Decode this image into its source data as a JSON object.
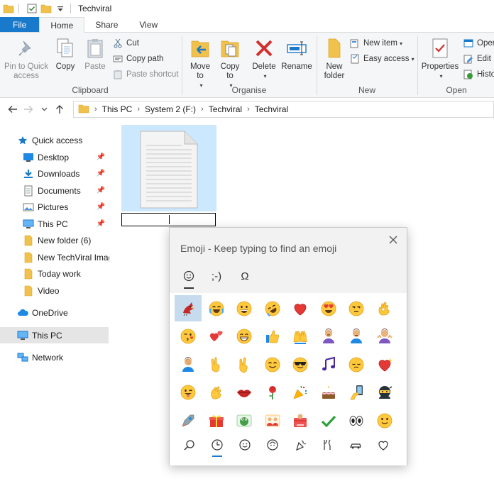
{
  "window": {
    "title": "Techviral"
  },
  "tabs": [
    {
      "label": "File"
    },
    {
      "label": "Home"
    },
    {
      "label": "Share"
    },
    {
      "label": "View"
    }
  ],
  "ribbon": {
    "clipboard": {
      "label": "Clipboard",
      "pin": "Pin to Quick access",
      "copy": "Copy",
      "paste": "Paste",
      "cut": "Cut",
      "copy_path": "Copy path",
      "paste_shortcut": "Paste shortcut"
    },
    "organise": {
      "label": "Organise",
      "move_to": "Move to",
      "copy_to": "Copy to",
      "delete": "Delete",
      "rename": "Rename"
    },
    "new": {
      "label": "New",
      "new_folder": "New folder",
      "new_item": "New item",
      "easy_access": "Easy access"
    },
    "open": {
      "label": "Open",
      "properties": "Properties",
      "open": "Open",
      "edit": "Edit",
      "history": "History"
    }
  },
  "breadcrumb": [
    "This PC",
    "System 2 (F:)",
    "Techviral",
    "Techviral"
  ],
  "nav": {
    "quick_access": "Quick access",
    "items": [
      {
        "label": "Desktop",
        "pinned": true
      },
      {
        "label": "Downloads",
        "pinned": true
      },
      {
        "label": "Documents",
        "pinned": true
      },
      {
        "label": "Pictures",
        "pinned": true
      },
      {
        "label": "This PC",
        "pinned": true
      },
      {
        "label": "New folder (6)",
        "pinned": false
      },
      {
        "label": "New TechViral Images",
        "pinned": false
      },
      {
        "label": "Today work",
        "pinned": false
      },
      {
        "label": "Video",
        "pinned": false
      }
    ],
    "onedrive": "OneDrive",
    "this_pc": "This PC",
    "network": "Network"
  },
  "emoji_panel": {
    "title": "Emoji - Keep typing to find an emoji",
    "categories": [
      "smiley-icon",
      "kaomoji-icon",
      "symbols-icon"
    ],
    "kaomoji_label": ";-)",
    "symbols_label": "Ω",
    "grid": [
      [
        "cardinal",
        "joy",
        "grin",
        "rofl",
        "heart",
        "heart-eyes",
        "unamused",
        "ok-hand"
      ],
      [
        "kiss",
        "two-hearts",
        "beaming",
        "thumbs-up",
        "raised-hands",
        "person-pouting",
        "person-frowning",
        "shrug"
      ],
      [
        "facepalm",
        "victory",
        "crossed-fingers",
        "smile",
        "sunglasses",
        "music-notes",
        "pensive",
        "sparkling-heart"
      ],
      [
        "wink-tongue",
        "clap",
        "lips",
        "rose",
        "party-popper",
        "cake",
        "selfie",
        "ninja"
      ],
      [
        "rocket-person",
        "gift-box",
        "frog-card",
        "family-card",
        "present",
        "check-mark",
        "eyes",
        "slight-smile"
      ]
    ],
    "bottom_tabs": [
      "search-icon",
      "recent-icon",
      "smileys-icon",
      "people-icon",
      "celebration-icon",
      "food-icon",
      "travel-icon",
      "heart-icon"
    ],
    "active_bottom": 1
  }
}
